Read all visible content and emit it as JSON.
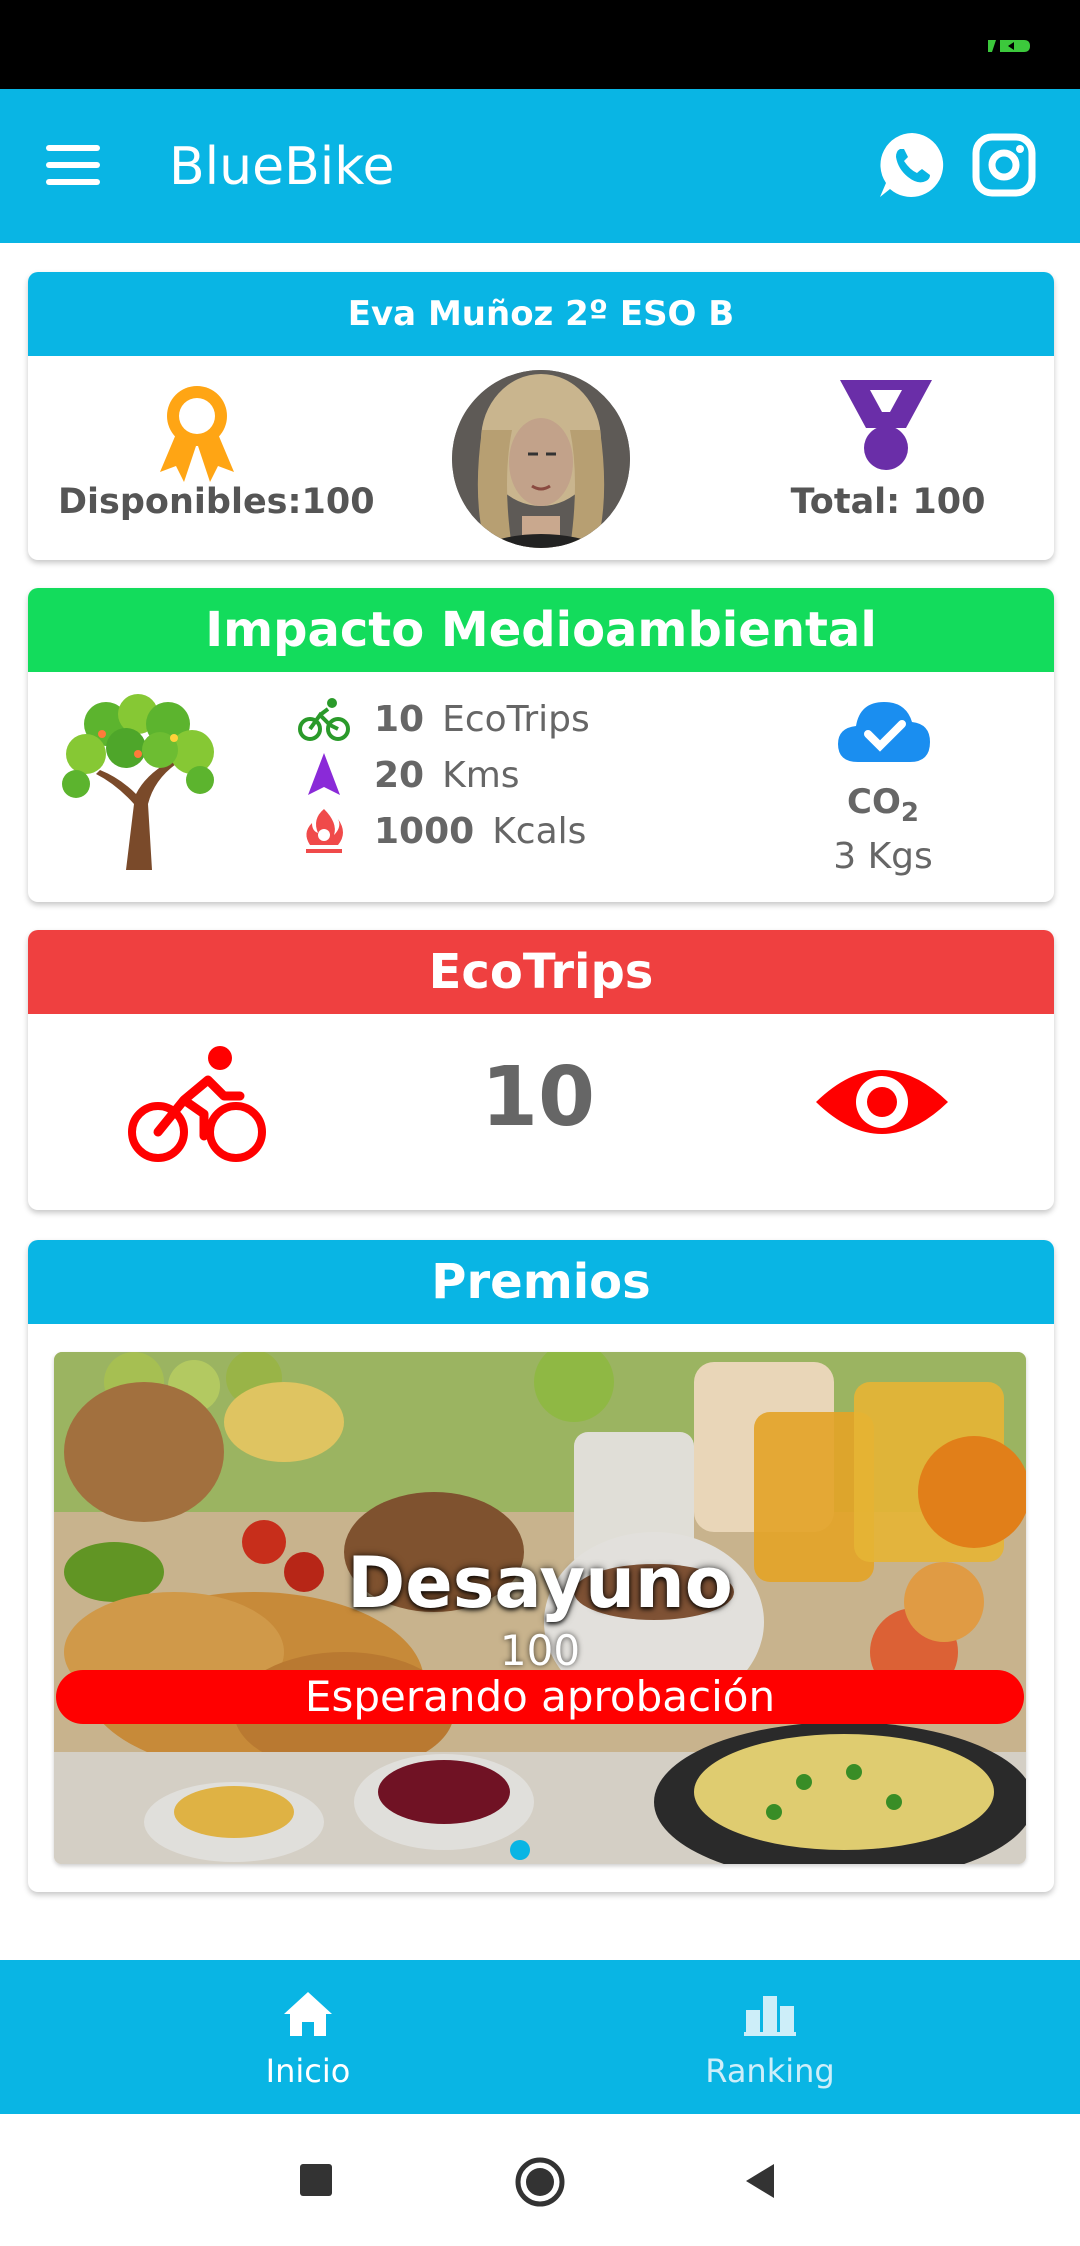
{
  "app": {
    "title": "BlueBike"
  },
  "colors": {
    "primary": "#09b5e4",
    "impact_header": "#13dc5c",
    "ecotrips_header": "#ef4040",
    "status_red": "#ff0000",
    "ribbon": "#ffa514",
    "medal": "#6a2ea8"
  },
  "icons": {
    "menu": "hamburger-menu-icon",
    "whatsapp": "whatsapp-icon",
    "instagram": "instagram-icon"
  },
  "user": {
    "name": "Eva Muñoz 2º ESO B",
    "available_label": "Disponibles:100",
    "total_label": "Total: 100"
  },
  "impact": {
    "header": "Impacto Medioambiental",
    "stats": [
      {
        "value": "10",
        "unit": "EcoTrips",
        "icon": "bike-icon"
      },
      {
        "value": "20",
        "unit": "Kms",
        "icon": "navigation-arrow-icon"
      },
      {
        "value": "1000",
        "unit": "Kcals",
        "icon": "fire-icon"
      }
    ],
    "co2_label": "CO",
    "co2_sub": "2",
    "co2_value": "3 Kgs"
  },
  "ecotrips": {
    "header": "EcoTrips",
    "count": "10"
  },
  "premios": {
    "header": "Premios",
    "items": [
      {
        "name": "Desayuno",
        "points": "100",
        "status": "Esperando aprobación"
      }
    ],
    "active_index": 0
  },
  "bottom_nav": {
    "items": [
      {
        "label": "Inicio",
        "icon": "home-icon",
        "active": true
      },
      {
        "label": "Ranking",
        "icon": "ranking-icon",
        "active": false
      }
    ]
  }
}
